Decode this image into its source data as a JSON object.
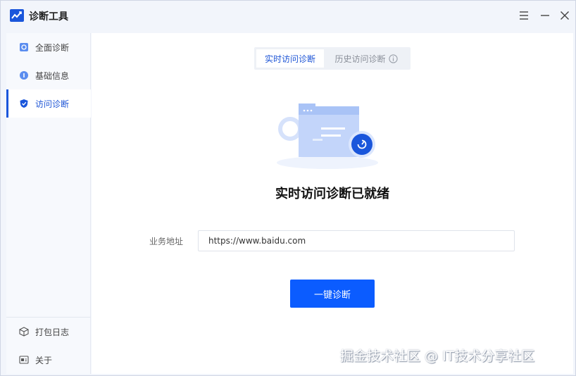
{
  "app": {
    "title": "诊断工具",
    "accent_color": "#1a56db",
    "logo_icon": "chart-line-icon"
  },
  "window_controls": {
    "menu_icon": "hamburger-icon",
    "minimize_icon": "minimize-icon",
    "close_icon": "close-icon"
  },
  "sidebar": {
    "items": [
      {
        "label": "全面诊断",
        "icon": "full-diagnosis-icon",
        "active": false
      },
      {
        "label": "基础信息",
        "icon": "basic-info-icon",
        "active": false
      },
      {
        "label": "访问诊断",
        "icon": "shield-icon",
        "active": true
      }
    ],
    "bottom_items": [
      {
        "label": "打包日志",
        "icon": "package-icon"
      },
      {
        "label": "关于",
        "icon": "about-icon"
      }
    ]
  },
  "tabs": {
    "realtime": "实时访问诊断",
    "history": "历史访问诊断",
    "history_icon": "info-icon"
  },
  "main": {
    "status_title": "实时访问诊断已就绪",
    "address_label": "业务地址",
    "address_value": "https://www.baidu.com",
    "diagnose_button": "一键诊断",
    "button_color": "#0b5cff"
  },
  "watermark": "掘金技术社区 @ IT技术分享社区"
}
